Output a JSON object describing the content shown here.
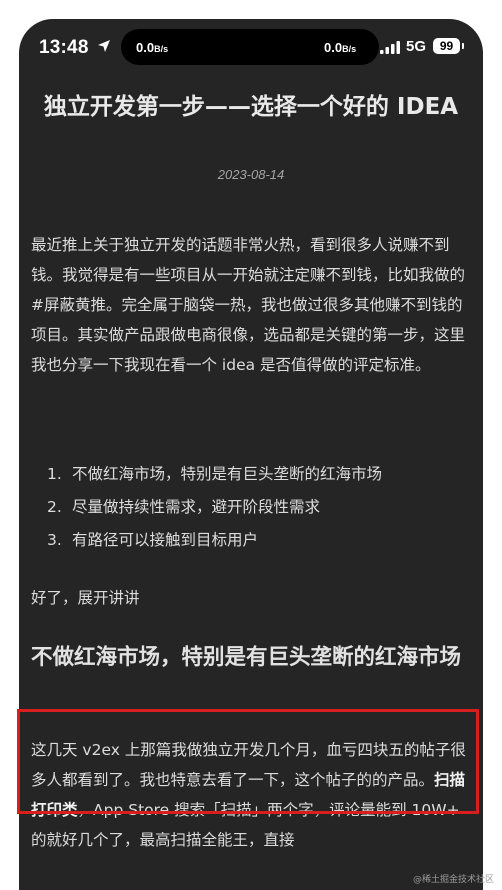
{
  "status_bar": {
    "time": "13:48",
    "speed_left_value": "0.0",
    "speed_left_unit": "B/s",
    "speed_right_value": "0.0",
    "speed_right_unit": "B/s",
    "network": "5G",
    "battery": "99"
  },
  "article": {
    "title": "独立开发第一步——选择一个好的 IDEA",
    "date": "2023-08-14",
    "intro": "最近推上关于独立开发的话题非常火热，看到很多人说赚不到钱。我觉得是有一些项目从一开始就注定赚不到钱，比如我做的 #屏蔽黄推。完全属于脑袋一热，我也做过很多其他赚不到钱的项目。其实做产品跟做电商很像，选品都是关键的第一步，这里我也分享一下我现在看一个 idea 是否值得做的评定标准。",
    "list": [
      {
        "num": "1.",
        "text": "不做红海市场，特别是有巨头垄断的红海市场"
      },
      {
        "num": "2.",
        "text": "尽量做持续性需求，避开阶段性需求"
      },
      {
        "num": "3.",
        "text": "有路径可以接触到目标用户"
      }
    ],
    "after_list": "好了，展开讲讲",
    "section_heading": "不做红海市场，特别是有巨头垄断的红海市场",
    "body_part1": "这几天 v2ex 上那篇我做独立开发几个月，血亏四块五的帖子很多人都看到了。我也特意去看了一下，这个帖子的的产品。",
    "body_bold": "扫描打印类",
    "body_part2": "，App Store 搜索「扫描」两个字，评论量能到 10W+ 的就好几个了，最高扫描全能王，直接"
  },
  "watermark": "@稀土掘金技术社区",
  "colors": {
    "background": "#252525",
    "text": "#dcdcdc",
    "highlight_border": "#d91e1e"
  }
}
